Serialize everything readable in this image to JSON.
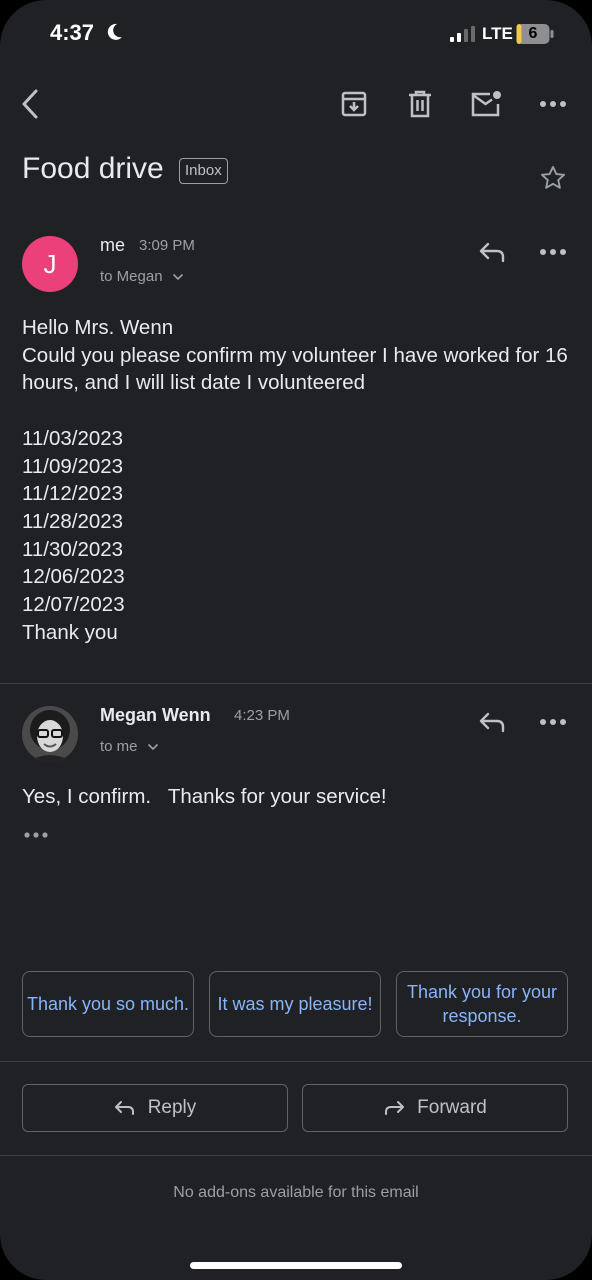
{
  "status_bar": {
    "time": "4:37",
    "network": "LTE",
    "battery": "6"
  },
  "thread": {
    "subject": "Food drive",
    "label": "Inbox"
  },
  "messages": [
    {
      "avatar_letter": "J",
      "sender": "me",
      "time": "3:09 PM",
      "recipient": "to Megan",
      "body": "Hello Mrs. Wenn\nCould you please confirm my volunteer I have worked for 16 hours, and I will list date I volunteered\n\n11/03/2023\n11/09/2023\n11/12/2023\n11/28/2023\n11/30/2023\n12/06/2023\n12/07/2023\nThank you"
    },
    {
      "sender": "Megan Wenn",
      "time": "4:23 PM",
      "recipient": "to me",
      "body": "Yes, I confirm.   Thanks for your service!"
    }
  ],
  "smart_replies": [
    "Thank you so much.",
    "It was my pleasure!",
    "Thank you for your response."
  ],
  "actions": {
    "reply": "Reply",
    "forward": "Forward"
  },
  "footer": "No add-ons available for this email",
  "colors": {
    "background": "#202124",
    "avatar": "#ec407a",
    "accent": "#8ab4f8"
  }
}
